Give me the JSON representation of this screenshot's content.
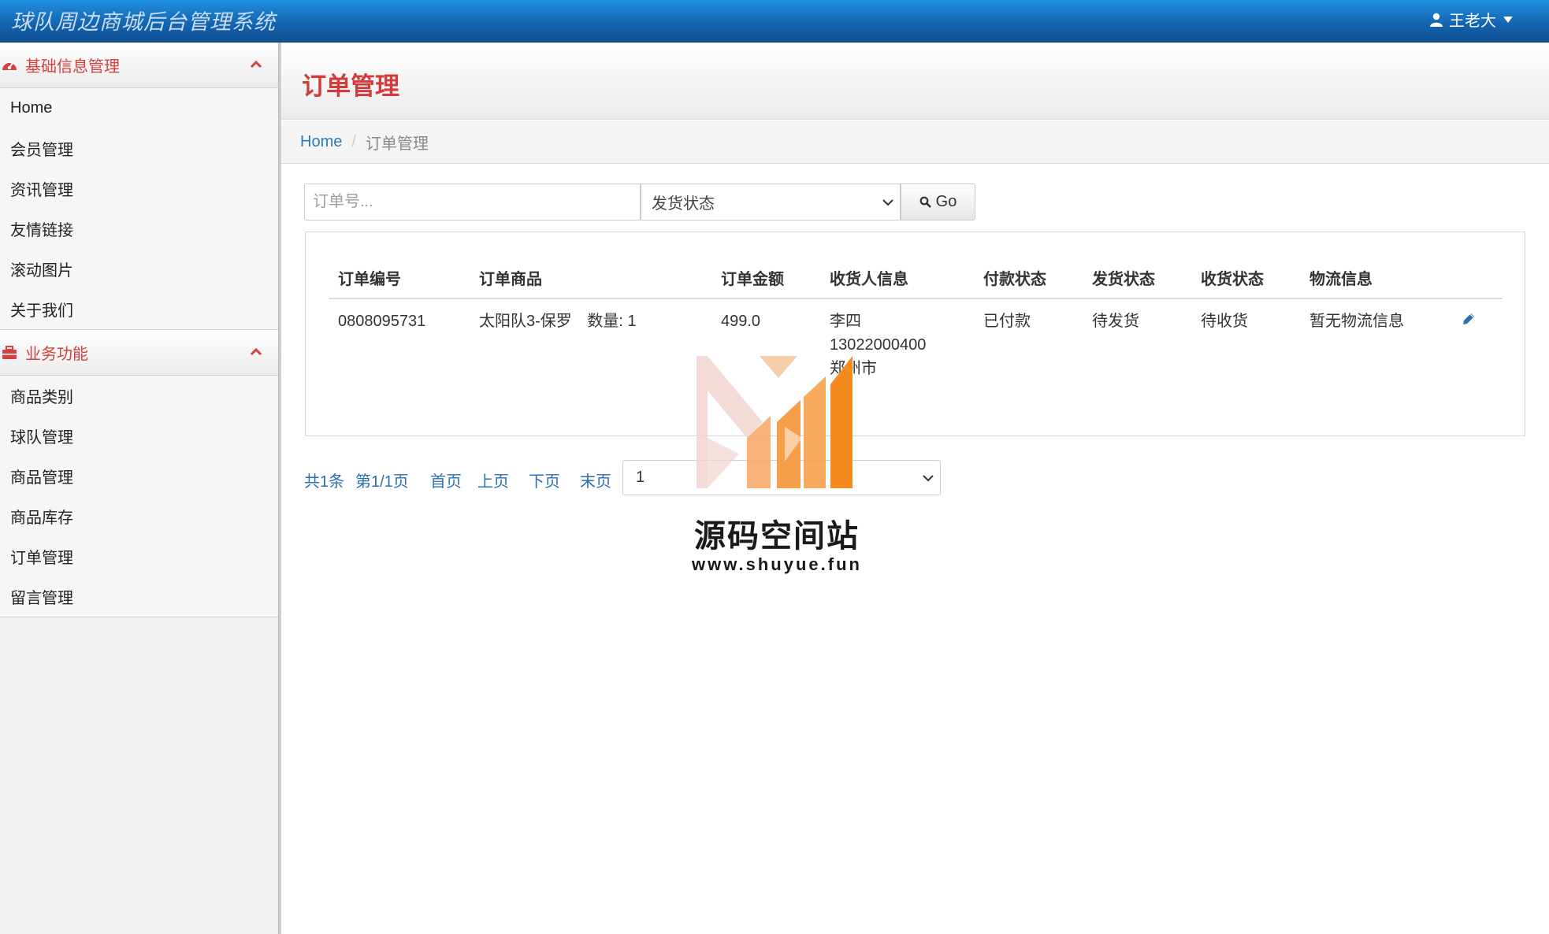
{
  "app": {
    "title": "球队周边商城后台管理系统",
    "user_name": "王老大"
  },
  "sidebar": {
    "groups": [
      {
        "label": "基础信息管理",
        "icon": "dashboard-icon",
        "items": [
          "Home",
          "会员管理",
          "资讯管理",
          "友情链接",
          "滚动图片",
          "关于我们"
        ]
      },
      {
        "label": "业务功能",
        "icon": "briefcase-icon",
        "items": [
          "商品类别",
          "球队管理",
          "商品管理",
          "商品库存",
          "订单管理",
          "留言管理"
        ]
      }
    ]
  },
  "page": {
    "title": "订单管理",
    "breadcrumb": {
      "home": "Home",
      "current": "订单管理"
    }
  },
  "filters": {
    "order_placeholder": "订单号...",
    "status_selected": "发货状态",
    "go_label": "Go"
  },
  "table": {
    "headers": [
      "订单编号",
      "订单商品",
      "订单金额",
      "收货人信息",
      "付款状态",
      "发货状态",
      "收货状态",
      "物流信息"
    ],
    "rows": [
      {
        "order_no": "0808095731",
        "product": "太阳队3-保罗",
        "qty_label": "数量:",
        "qty": "1",
        "amount": "499.0",
        "receiver_name": "李四",
        "receiver_phone": "13022000400",
        "receiver_city": "郑州市",
        "pay_status": "已付款",
        "ship_status": "待发货",
        "receive_status": "待收货",
        "logistics": "暂无物流信息"
      }
    ]
  },
  "pagination": {
    "total": "共1条",
    "page_info": "第1/1页",
    "first": "首页",
    "prev": "上页",
    "next": "下页",
    "last": "末页",
    "page_select": "1"
  },
  "watermark": {
    "title": "源码空间站",
    "url": "www.shuyue.fun"
  },
  "colors": {
    "topbar": "#1463ae",
    "accent_red": "#d33a3a",
    "link_blue": "#2a6fb0"
  }
}
